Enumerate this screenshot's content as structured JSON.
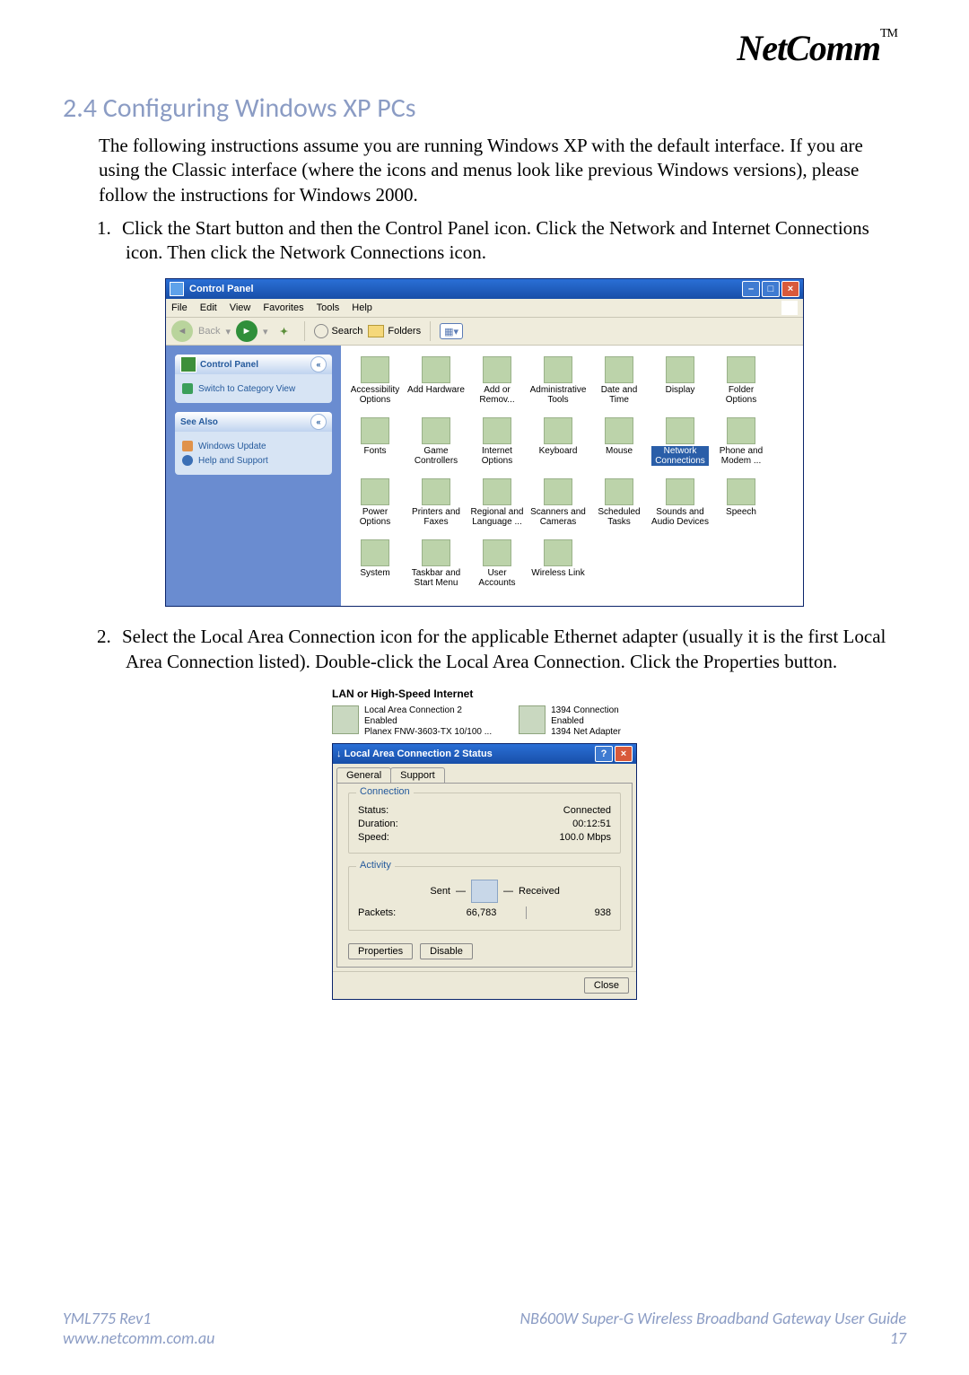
{
  "brand": "NetComm",
  "brand_tm": "TM",
  "heading": "2.4 Configuring Windows XP PCs",
  "intro": "The following instructions assume you are running Windows XP with the default interface. If you are using the Classic interface (where the icons and menus look like previous Windows versions), please follow the instructions for Windows 2000.",
  "steps": {
    "s1": {
      "num": "1.",
      "text": "Click the Start button and then the Control Panel icon. Click the Network and Internet Connections icon. Then click the Network Connections icon."
    },
    "s2": {
      "num": "2.",
      "text": "Select the Local Area Connection icon for the applicable Ethernet adapter (usually it is the first Local Area Connection listed). Double-click the Local Area Connection. Click the Properties button."
    }
  },
  "cp": {
    "title": "Control Panel",
    "menu": {
      "file": "File",
      "edit": "Edit",
      "view": "View",
      "favorites": "Favorites",
      "tools": "Tools",
      "help": "Help"
    },
    "nav": {
      "back": "Back",
      "search": "Search",
      "folders": "Folders"
    },
    "panel1": {
      "title": "Control Panel",
      "link": "Switch to Category View"
    },
    "panel2": {
      "title": "See Also",
      "link1": "Windows Update",
      "link2": "Help and Support"
    },
    "items": [
      [
        "Accessibility Options",
        "Add Hardware",
        "Add or Remov...",
        "Administrative Tools",
        "Date and Time",
        "Display",
        "Folder Options"
      ],
      [
        "Fonts",
        "Game Controllers",
        "Internet Options",
        "Keyboard",
        "Mouse",
        "Network Connections",
        "Phone and Modem ..."
      ],
      [
        "Power Options",
        "Printers and Faxes",
        "Regional and Language ...",
        "Scanners and Cameras",
        "Scheduled Tasks",
        "Sounds and Audio Devices",
        "Speech"
      ],
      [
        "System",
        "Taskbar and Start Menu",
        "User Accounts",
        "Wireless Link",
        "",
        "",
        ""
      ]
    ],
    "selected": "Network Connections"
  },
  "status": {
    "section_title": "LAN or High-Speed Internet",
    "conn1": {
      "name": "Local Area Connection 2",
      "state": "Enabled",
      "adapter": "Planex FNW-3603-TX 10/100 ..."
    },
    "conn2": {
      "name": "1394 Connection",
      "state": "Enabled",
      "adapter": "1394 Net Adapter"
    },
    "dlg_title": "Local Area Connection 2 Status",
    "tabs": {
      "general": "General",
      "support": "Support"
    },
    "connection": {
      "legend": "Connection",
      "status_l": "Status:",
      "status_v": "Connected",
      "duration_l": "Duration:",
      "duration_v": "00:12:51",
      "speed_l": "Speed:",
      "speed_v": "100.0 Mbps"
    },
    "activity": {
      "legend": "Activity",
      "sent": "Sent",
      "received": "Received",
      "packets_l": "Packets:",
      "packets_sent": "66,783",
      "packets_recv": "938"
    },
    "btn_properties": "Properties",
    "btn_disable": "Disable",
    "btn_close": "Close"
  },
  "footer": {
    "l1_left": "YML775 Rev1",
    "l1_right": "NB600W Super-G Wireless Broadband  Gateway User Guide",
    "l2_left": "www.netcomm.com.au",
    "l2_right": "17"
  }
}
